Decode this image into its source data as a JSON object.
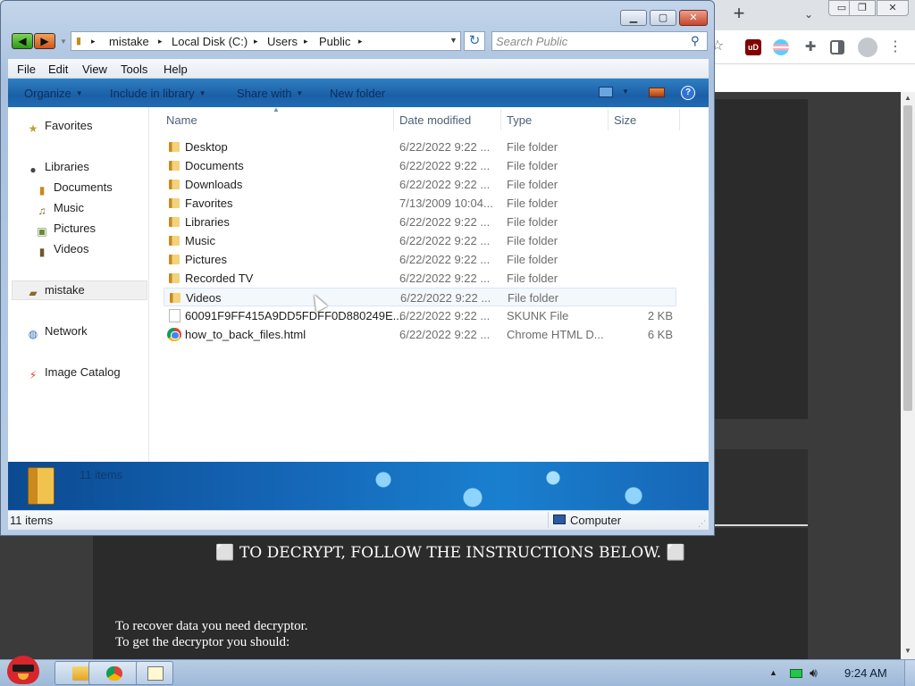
{
  "browser": {
    "new_tab_label": "+",
    "tab_search_icon": "chevron-down-icon",
    "window_buttons": {
      "minimize": "▭",
      "restore": "❐",
      "close": "✕"
    },
    "extensions": [
      "star-icon",
      "ublock-icon",
      "flag-icon",
      "puzzle-icon",
      "sidepanel-icon",
      "profile-icon",
      "menu-icon"
    ],
    "ublock_label": "uD",
    "page": {
      "headline": "⬜ TO DECRYPT, FOLLOW THE INSTRUCTIONS BELOW. ⬜",
      "lines": [
        "To recover data you need decryptor.",
        "To get the decryptor you should:"
      ]
    }
  },
  "explorer": {
    "caption_buttons": {
      "minimize": "▁",
      "maximize": "▢",
      "close": "✕"
    },
    "nav": {
      "back": "◀",
      "forward": "▶"
    },
    "address": {
      "crumbs": [
        "mistake",
        "Local Disk (C:)",
        "Users",
        "Public"
      ],
      "separator": "▸"
    },
    "search": {
      "placeholder": "Search Public"
    },
    "menu": [
      "File",
      "Edit",
      "View",
      "Tools",
      "Help"
    ],
    "commands": [
      "Organize",
      "Include in library",
      "Share with",
      "New folder"
    ],
    "help_label": "?",
    "navpane": {
      "favorites": "Favorites",
      "libraries": "Libraries",
      "library_items": [
        "Documents",
        "Music",
        "Pictures",
        "Videos"
      ],
      "computer": "mistake",
      "network": "Network",
      "image_catalog": "Image Catalog"
    },
    "columns": {
      "name": "Name",
      "date": "Date modified",
      "type": "Type",
      "size": "Size"
    },
    "files": [
      {
        "name": "Desktop",
        "date": "6/22/2022 9:22 ...",
        "type": "File folder",
        "size": "",
        "kind": "folder"
      },
      {
        "name": "Documents",
        "date": "6/22/2022 9:22 ...",
        "type": "File folder",
        "size": "",
        "kind": "folder"
      },
      {
        "name": "Downloads",
        "date": "6/22/2022 9:22 ...",
        "type": "File folder",
        "size": "",
        "kind": "folder"
      },
      {
        "name": "Favorites",
        "date": "7/13/2009 10:04...",
        "type": "File folder",
        "size": "",
        "kind": "folder"
      },
      {
        "name": "Libraries",
        "date": "6/22/2022 9:22 ...",
        "type": "File folder",
        "size": "",
        "kind": "folder"
      },
      {
        "name": "Music",
        "date": "6/22/2022 9:22 ...",
        "type": "File folder",
        "size": "",
        "kind": "folder"
      },
      {
        "name": "Pictures",
        "date": "6/22/2022 9:22 ...",
        "type": "File folder",
        "size": "",
        "kind": "folder"
      },
      {
        "name": "Recorded TV",
        "date": "6/22/2022 9:22 ...",
        "type": "File folder",
        "size": "",
        "kind": "folder"
      },
      {
        "name": "Videos",
        "date": "6/22/2022 9:22 ...",
        "type": "File folder",
        "size": "",
        "kind": "folder"
      },
      {
        "name": "60091F9FF415A9DD5FDFF0D880249E...",
        "date": "6/22/2022 9:22 ...",
        "type": "SKUNK File",
        "size": "2 KB",
        "kind": "file"
      },
      {
        "name": "how_to_back_files.html",
        "date": "6/22/2022 9:22 ...",
        "type": "Chrome HTML D...",
        "size": "6 KB",
        "kind": "html"
      }
    ],
    "details_text": "11 items",
    "status": {
      "count": "11 items",
      "location": "Computer"
    }
  },
  "taskbar": {
    "buttons": [
      "explorer-icon",
      "chrome-icon",
      "notepad-icon"
    ],
    "clock": "9:24 AM"
  }
}
